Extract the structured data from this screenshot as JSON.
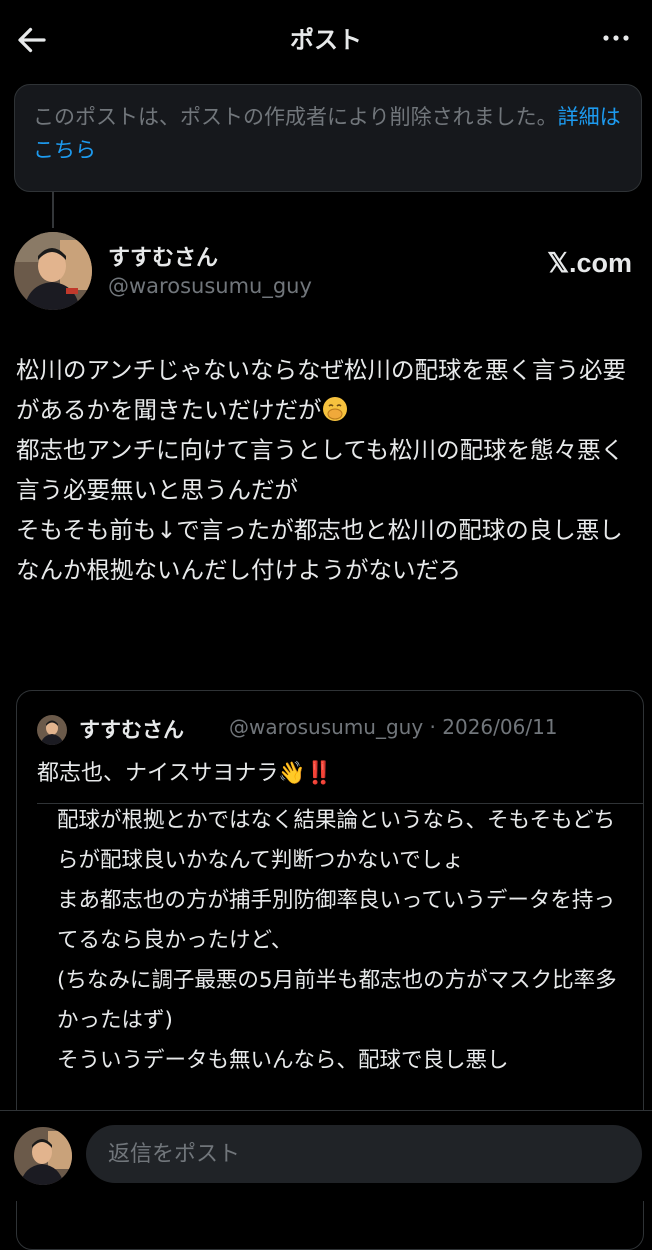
{
  "header": {
    "title": "ポスト",
    "back_icon": "arrow-left-icon",
    "more_icon": "more-horizontal-icon"
  },
  "deleted_notice": {
    "text": "このポストは、ポストの作成者により削除されました。",
    "link": "詳細はこちら"
  },
  "author": {
    "name": "すすむさん",
    "handle": "@warosusumu_guy",
    "source_badge": "𝕏.com"
  },
  "post": {
    "text": "松川のアンチじゃないならなぜ松川の配球を悪く言う必要があるかを聞きたいだけだが",
    "emoji": "face-with-hand-over-mouth",
    "text_after": "\n都志也アンチに向けて言うとしても松川の配球を態々悪く言う必要無いと思うんだが\nそもそも前も↓で言ったが都志也と松川の配球の良し悪しなんか根拠ないんだし付けようがないだろ"
  },
  "quote": {
    "name": "すすむさん",
    "handle_date": "@warosusumu_guy · 2026/06/11",
    "text": "都志也、ナイスサヨナラ👋‼️",
    "body": "配球が根拠とかではなく結果論というなら、そもそもどちらが配球良いかなんて判断つかないでしょ\nまあ都志也の方が捕手別防御率良いっていうデータを持ってるなら良かったけど、\n(ちなみに調子最悪の5月前半も都志也の方がマスク比率多かったはず)\nそういうデータも無いんなら、配球で良し悪し"
  },
  "reply": {
    "placeholder": "返信をポスト"
  },
  "colors": {
    "background": "#000000",
    "text": "#e7e9ea",
    "muted": "#71767b",
    "link": "#1d9bf0",
    "border": "#2f3336"
  }
}
